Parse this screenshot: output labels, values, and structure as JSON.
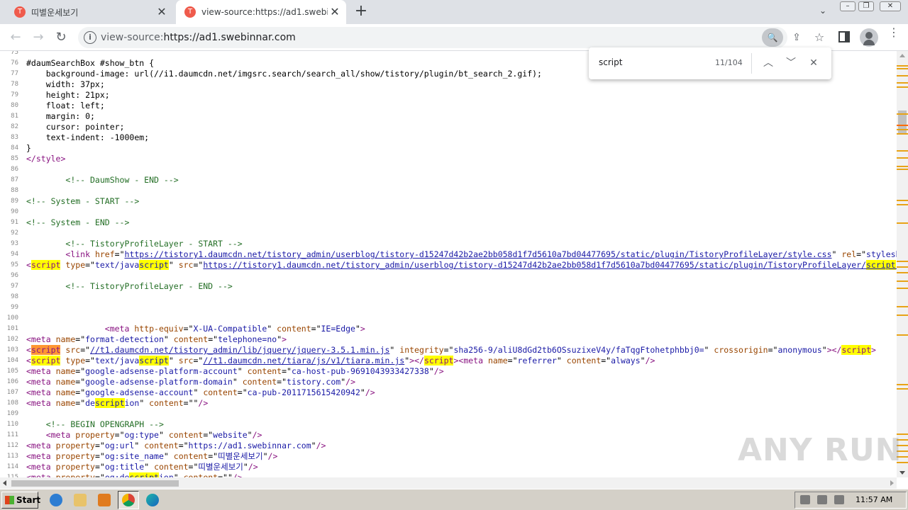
{
  "tabs": [
    {
      "title": "띠별운세보기",
      "favicon": "T"
    },
    {
      "title": "view-source:https://ad1.swebinnar.",
      "favicon": "T"
    }
  ],
  "omnibox": {
    "prefix": "view-source:",
    "url": "https://ad1.swebinnar.com"
  },
  "find": {
    "query": "script",
    "count": "11/104"
  },
  "source_lines": [
    {
      "n": "75",
      "html": ""
    },
    {
      "n": "76",
      "html": "#daumSearchBox #show_btn {"
    },
    {
      "n": "77",
      "html": "    background-image: url(//i1.daumcdn.net/imgsrc.search/search_all/show/tistory/plugin/bt_search_2.gif);"
    },
    {
      "n": "78",
      "html": "    width: 37px;"
    },
    {
      "n": "79",
      "html": "    height: 21px;"
    },
    {
      "n": "80",
      "html": "    float: left;"
    },
    {
      "n": "81",
      "html": "    margin: 0;"
    },
    {
      "n": "82",
      "html": "    cursor: pointer;"
    },
    {
      "n": "83",
      "html": "    text-indent: -1000em;"
    },
    {
      "n": "84",
      "html": "}"
    },
    {
      "n": "85",
      "html": "<span class='t'>&lt;/style&gt;</span>"
    },
    {
      "n": "86",
      "html": ""
    },
    {
      "n": "87",
      "html": "        <span class='c'>&lt;!-- DaumShow - END --&gt;</span>"
    },
    {
      "n": "88",
      "html": ""
    },
    {
      "n": "89",
      "html": "<span class='c'>&lt;!-- System - START --&gt;</span>"
    },
    {
      "n": "90",
      "html": ""
    },
    {
      "n": "91",
      "html": "<span class='c'>&lt;!-- System - END --&gt;</span>"
    },
    {
      "n": "92",
      "html": ""
    },
    {
      "n": "93",
      "html": "        <span class='c'>&lt;!-- TistoryProfileLayer - START --&gt;</span>"
    },
    {
      "n": "94",
      "html": "        <span class='t'>&lt;link</span> <span class='a'>href</span>=\"<span class='l'>https://tistory1.daumcdn.net/tistory_admin/userblog/tistory-d15247d42b2ae2bb058d1f7d5610a7bd04477695/static/plugin/TistoryProfileLayer/style.css</span>\" <span class='a'>rel</span>=\"<span class='v'>stylesheet</span>\""
    },
    {
      "n": "95",
      "html": "<span class='t'>&lt;<span class='hl'>script</span></span> <span class='a'>type</span>=\"<span class='v'>text/java<span class='hl'>script</span></span>\" <span class='a'>src</span>=\"<span class='l'>https://tistory1.daumcdn.net/tistory_admin/userblog/tistory-d15247d42b2ae2bb058d1f7d5610a7bd04477695/static/plugin/TistoryProfileLayer/<span class='hl'>script</span>.js</span>\""
    },
    {
      "n": "96",
      "html": ""
    },
    {
      "n": "97",
      "html": "        <span class='c'>&lt;!-- TistoryProfileLayer - END --&gt;</span>"
    },
    {
      "n": "98",
      "html": ""
    },
    {
      "n": "99",
      "html": ""
    },
    {
      "n": "100",
      "html": ""
    },
    {
      "n": "101",
      "html": "                <span class='t'>&lt;meta</span> <span class='a'>http-equiv</span>=\"<span class='v'>X-UA-Compatible</span>\" <span class='a'>content</span>=\"<span class='v'>IE=Edge</span>\"<span class='t'>&gt;</span>"
    },
    {
      "n": "102",
      "html": "<span class='t'>&lt;meta</span> <span class='a'>name</span>=\"<span class='v'>format-detection</span>\" <span class='a'>content</span>=\"<span class='v'>telephone=no</span>\"<span class='t'>&gt;</span>"
    },
    {
      "n": "103",
      "html": "<span class='t'>&lt;<span class='hl-cur'>script</span></span> <span class='a'>src</span>=\"<span class='l'>//t1.daumcdn.net/tistory_admin/lib/jquery/jquery-3.5.1.min.js</span>\" <span class='a'>integrity</span>=\"<span class='v'>sha256-9/aliU8dGd2tb6OSsuzixeV4y/faTqgFtohetphbbj0=</span>\" <span class='a'>crossorigin</span>=\"<span class='v'>anonymous</span>\"<span class='t'>&gt;&lt;/<span class='hl'>script</span>&gt;</span>"
    },
    {
      "n": "104",
      "html": "<span class='t'>&lt;<span class='hl'>script</span></span> <span class='a'>type</span>=\"<span class='v'>text/java<span class='hl'>script</span></span>\" <span class='a'>src</span>=\"<span class='l'>//t1.daumcdn.net/tiara/js/v1/tiara.min.js</span>\"<span class='t'>&gt;&lt;/<span class='hl'>script</span>&gt;&lt;meta</span> <span class='a'>name</span>=\"<span class='v'>referrer</span>\" <span class='a'>content</span>=\"<span class='v'>always</span>\"<span class='t'>/&gt;</span>"
    },
    {
      "n": "105",
      "html": "<span class='t'>&lt;meta</span> <span class='a'>name</span>=\"<span class='v'>google-adsense-platform-account</span>\" <span class='a'>content</span>=\"<span class='v'>ca-host-pub-9691043933427338</span>\"<span class='t'>/&gt;</span>"
    },
    {
      "n": "106",
      "html": "<span class='t'>&lt;meta</span> <span class='a'>name</span>=\"<span class='v'>google-adsense-platform-domain</span>\" <span class='a'>content</span>=\"<span class='v'>tistory.com</span>\"<span class='t'>/&gt;</span>"
    },
    {
      "n": "107",
      "html": "<span class='t'>&lt;meta</span> <span class='a'>name</span>=\"<span class='v'>google-adsense-account</span>\" <span class='a'>content</span>=\"<span class='v'>ca-pub-2011715615420942</span>\"<span class='t'>/&gt;</span>"
    },
    {
      "n": "108",
      "html": "<span class='t'>&lt;meta</span> <span class='a'>name</span>=\"<span class='v'>de<span class='hl'>script</span>ion</span>\" <span class='a'>content</span>=\"\"<span class='t'>/&gt;</span>"
    },
    {
      "n": "109",
      "html": ""
    },
    {
      "n": "110",
      "html": "    <span class='c'>&lt;!-- BEGIN OPENGRAPH --&gt;</span>"
    },
    {
      "n": "111",
      "html": "    <span class='t'>&lt;meta</span> <span class='a'>property</span>=\"<span class='v'>og:type</span>\" <span class='a'>content</span>=\"<span class='v'>website</span>\"<span class='t'>/&gt;</span>"
    },
    {
      "n": "112",
      "html": "<span class='t'>&lt;meta</span> <span class='a'>property</span>=\"<span class='v'>og:url</span>\" <span class='a'>content</span>=\"<span class='v'>https://ad1.swebinnar.com</span>\"<span class='t'>/&gt;</span>"
    },
    {
      "n": "113",
      "html": "<span class='t'>&lt;meta</span> <span class='a'>property</span>=\"<span class='v'>og:site_name</span>\" <span class='a'>content</span>=\"<span class='v'>띠별운세보기</span>\"<span class='t'>/&gt;</span>"
    },
    {
      "n": "114",
      "html": "<span class='t'>&lt;meta</span> <span class='a'>property</span>=\"<span class='v'>og:title</span>\" <span class='a'>content</span>=\"<span class='v'>띠별운세보기</span>\"<span class='t'>/&gt;</span>"
    },
    {
      "n": "115",
      "html": "<span class='t'>&lt;meta</span> <span class='a'>property</span>=\"<span class='v'>og:de<span class='hl'>script</span>ion</span>\" <span class='a'>content</span>=\"\"<span class='t'>/&gt;</span>"
    }
  ],
  "watermark": "ANY RUN",
  "taskbar": {
    "start_label": "Start",
    "clock": "11:57 AM"
  },
  "colors": {
    "accent": "#ef5b4c",
    "match_highlight": "#ffff00",
    "current_match": "#ff9632"
  }
}
